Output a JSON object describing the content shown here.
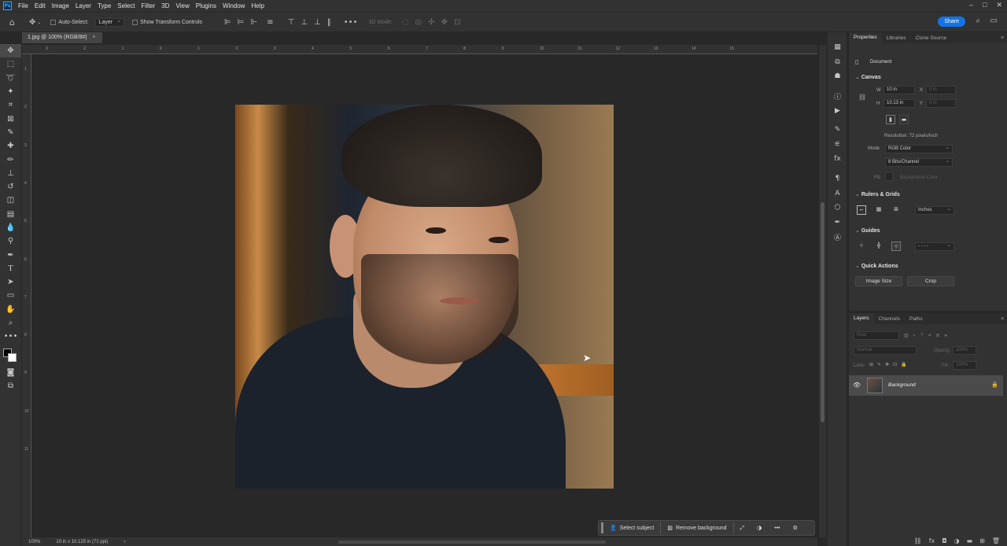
{
  "app": {
    "logo_text": "Ps"
  },
  "menu": [
    "File",
    "Edit",
    "Image",
    "Layer",
    "Type",
    "Select",
    "Filter",
    "3D",
    "View",
    "Plugins",
    "Window",
    "Help"
  ],
  "window_controls": [
    "–",
    "□",
    "✕"
  ],
  "options_bar": {
    "auto_select_label": "Auto-Select:",
    "auto_select_value": "Layer",
    "transform_controls_label": "Show Transform Controls",
    "mode_3d_label": "3D Mode:",
    "share_label": "Share"
  },
  "document_tab": {
    "title": "1.jpg @ 100% (RGB/8#)",
    "close": "×"
  },
  "ruler_top": [
    "3",
    "2",
    "1",
    "0",
    "1",
    "2",
    "3",
    "4",
    "5",
    "6",
    "7",
    "8",
    "9",
    "10",
    "11",
    "12",
    "13",
    "14",
    "15"
  ],
  "ruler_left": [
    "1",
    "2",
    "3",
    "4",
    "5",
    "6",
    "7",
    "8",
    "9",
    "10",
    "11"
  ],
  "context_bar": {
    "select_subject": "Select subject",
    "remove_background": "Remove background"
  },
  "status_bar": {
    "zoom": "100%",
    "doc_size": "10 in x 10.125 in (72 ppi)",
    "arrow": "›"
  },
  "properties": {
    "tabs": [
      "Properties",
      "Libraries",
      "Clone Source"
    ],
    "document_label": "Document",
    "canvas": {
      "section": "Canvas",
      "w_label": "W",
      "w_value": "10 in",
      "h_label": "H",
      "h_value": "10.13 in",
      "x_label": "X",
      "x_value": "0 in",
      "y_label": "Y",
      "y_value": "0 in",
      "resolution": "Resolution: 72 pixels/inch",
      "mode_label": "Mode",
      "mode_value": "RGB Color",
      "bits_value": "8 Bits/Channel",
      "fill_label": "Fill",
      "fill_value": "Background Color"
    },
    "rulers_grids": {
      "section": "Rulers & Grids",
      "units": "Inches"
    },
    "guides": {
      "section": "Guides",
      "style": "- - - -"
    },
    "quick_actions": {
      "section": "Quick Actions",
      "image_size": "Image Size",
      "crop": "Crop"
    }
  },
  "layers": {
    "tabs": [
      "Layers",
      "Channels",
      "Paths"
    ],
    "kind_placeholder": "Kind",
    "blend_mode": "Normal",
    "opacity_label": "Opacity:",
    "opacity_value": "100%",
    "lock_label": "Lock:",
    "fill_label": "Fill:",
    "fill_value": "100%",
    "items": [
      {
        "name": "Background",
        "visible": true,
        "locked": true
      }
    ]
  }
}
